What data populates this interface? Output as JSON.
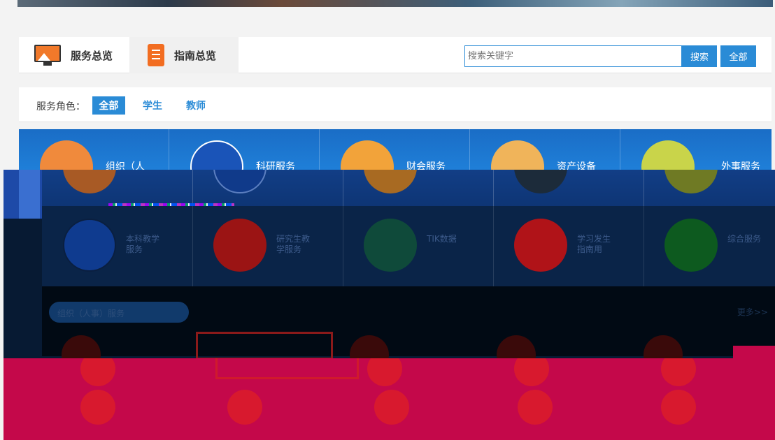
{
  "tabs": [
    {
      "label": "服务总览",
      "icon": "monitor-icon"
    },
    {
      "label": "指南总览",
      "icon": "notebook-icon"
    }
  ],
  "search": {
    "placeholder": "搜索关键字",
    "search_label": "搜索",
    "all_label": "全部"
  },
  "roles": {
    "label": "服务角色：",
    "items": [
      "全部",
      "学生",
      "教师"
    ]
  },
  "services_row1": [
    {
      "label": "组织（人\n事）服务",
      "color": "#f08a3c"
    },
    {
      "label": "科研服务",
      "color": "#1a54b8"
    },
    {
      "label": "财会服务",
      "color": "#f2a33a"
    },
    {
      "label": "资产设备\n服务",
      "color": "#f0b45a"
    },
    {
      "label": "外事服务",
      "color": "#c9d44a"
    }
  ],
  "services_row2": [
    {
      "label": "本科教学\n服务",
      "color": "#0f3b8f"
    },
    {
      "label": "研究生教\n学服务",
      "color": "#9b1414"
    },
    {
      "label": "TIK数据",
      "color": "#0f4a3a"
    },
    {
      "label": "学习发生\n指南用",
      "color": "#b01318"
    },
    {
      "label": "综合服务",
      "color": "#0d5a1f"
    }
  ],
  "section": {
    "title": "组织（人事）服务",
    "more": "更多>>"
  },
  "colors": {
    "accent": "#2a8bd6",
    "glitch_dark": "#071a33",
    "glitch_red": "#c4084a"
  }
}
